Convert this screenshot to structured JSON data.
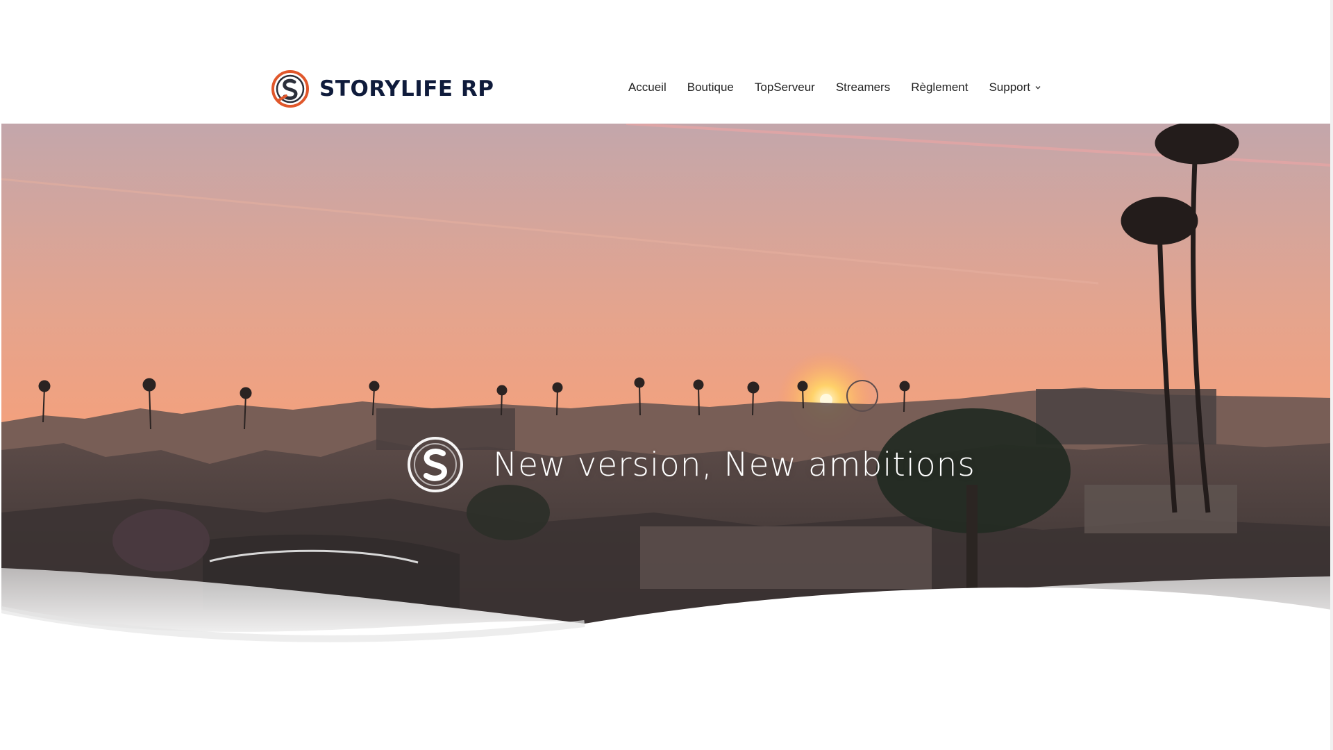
{
  "header": {
    "brand_name": "STORYLIFE RP",
    "logo_icon": "storylife-s-logo-icon",
    "nav": [
      {
        "label": "Accueil"
      },
      {
        "label": "Boutique"
      },
      {
        "label": "TopServeur"
      },
      {
        "label": "Streamers"
      },
      {
        "label": "Règlement"
      },
      {
        "label": "Support",
        "has_dropdown": true,
        "icon": "chevron-down-icon"
      }
    ]
  },
  "hero": {
    "title": "New version, New ambitions",
    "logo_icon": "storylife-s-logo-icon"
  },
  "colors": {
    "brand_text": "#0f1b3b",
    "logo_orange": "#e0572b",
    "sky_top": "#c9a7a8",
    "sky_horizon": "#f6a07a"
  }
}
